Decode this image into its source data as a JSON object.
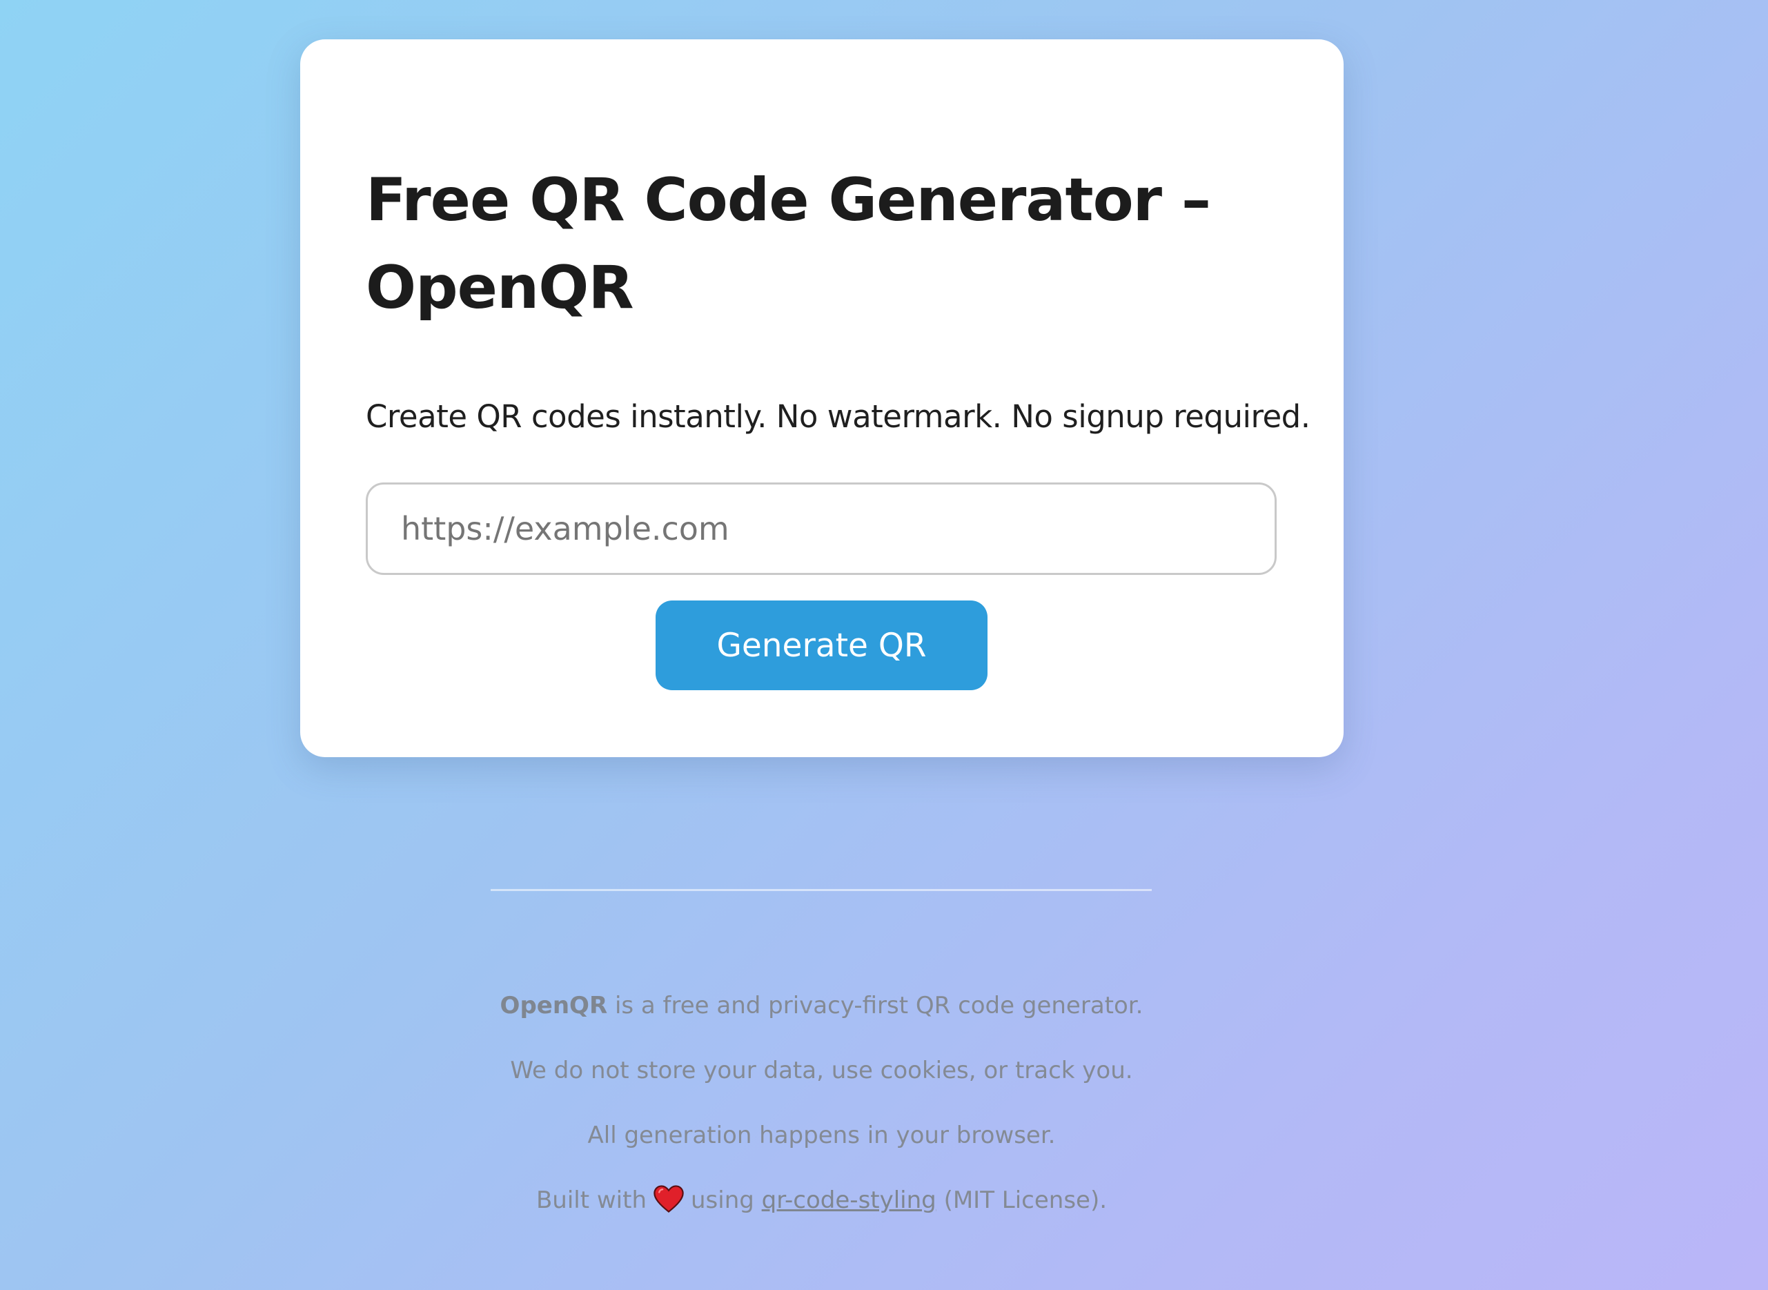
{
  "card": {
    "title": "Free QR Code Generator – OpenQR",
    "subtitle": "Create QR codes instantly. No watermark. No signup required.",
    "url_input": {
      "value": "",
      "placeholder": "https://example.com"
    },
    "generate_button_label": "Generate QR"
  },
  "footer": {
    "line1": {
      "brand": "OpenQR",
      "text": " is a free and privacy-first QR code generator."
    },
    "line2": "We do not store your data, use cookies, or track you.",
    "line3": "All generation happens in your browser.",
    "line4": {
      "prefix": "Built with",
      "heart_icon": "heart-icon",
      "middle": "using",
      "link_text": "qr-code-styling",
      "suffix": "(MIT License)."
    }
  },
  "colors": {
    "accent": "#2e9ddc",
    "heart": "#e0202a",
    "background_start": "#8fd3f4",
    "background_end": "#bab6f8"
  }
}
